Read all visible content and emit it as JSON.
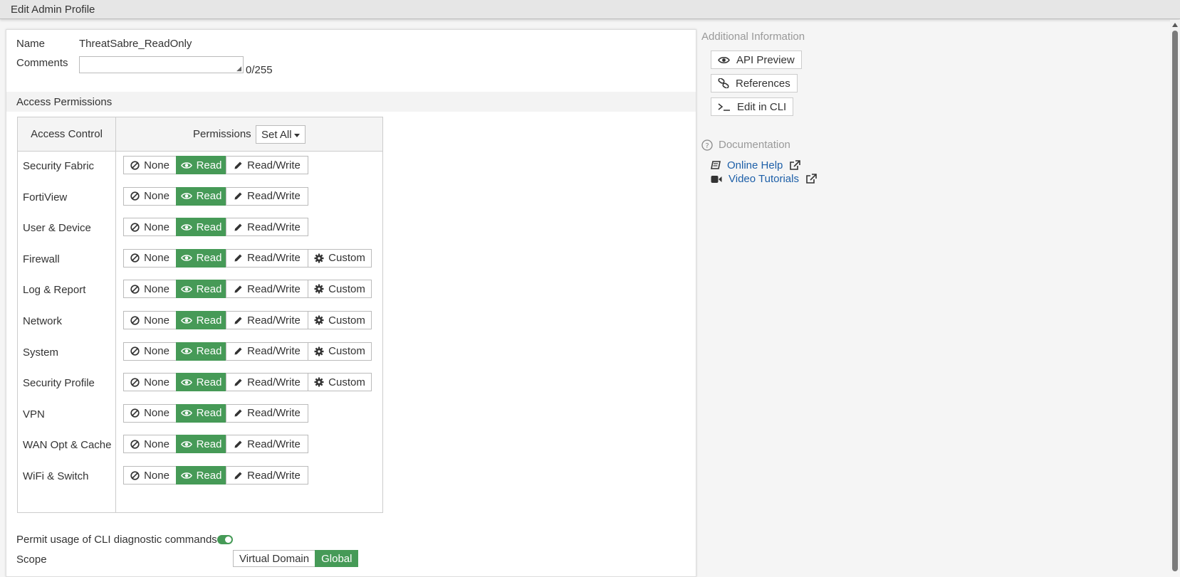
{
  "window": {
    "title": "Edit Admin Profile"
  },
  "form": {
    "name_label": "Name",
    "name_value": "ThreatSabre_ReadOnly",
    "comments_label": "Comments",
    "comments_value": "",
    "comments_count": "0/255"
  },
  "access": {
    "section_title": "Access Permissions",
    "col_access": "Access Control",
    "col_permissions": "Permissions",
    "set_all_label": "Set All",
    "option_labels": {
      "none": "None",
      "read": "Read",
      "readwrite": "Read/Write",
      "custom": "Custom"
    },
    "rows": [
      {
        "label": "Security Fabric",
        "selected": "read",
        "custom": false
      },
      {
        "label": "FortiView",
        "selected": "read",
        "custom": false
      },
      {
        "label": "User & Device",
        "selected": "read",
        "custom": false
      },
      {
        "label": "Firewall",
        "selected": "read",
        "custom": true
      },
      {
        "label": "Log & Report",
        "selected": "read",
        "custom": true
      },
      {
        "label": "Network",
        "selected": "read",
        "custom": true
      },
      {
        "label": "System",
        "selected": "read",
        "custom": true
      },
      {
        "label": "Security Profile",
        "selected": "read",
        "custom": true
      },
      {
        "label": "VPN",
        "selected": "read",
        "custom": false
      },
      {
        "label": "WAN Opt & Cache",
        "selected": "read",
        "custom": false
      },
      {
        "label": "WiFi & Switch",
        "selected": "read",
        "custom": false
      }
    ]
  },
  "cli": {
    "label": "Permit usage of CLI diagnostic commands",
    "enabled": true
  },
  "scope": {
    "label": "Scope",
    "options": [
      "Virtual Domain",
      "Global"
    ],
    "selected": "Global"
  },
  "side": {
    "title": "Additional Information",
    "api_preview": "API Preview",
    "references": "References",
    "edit_cli": "Edit in CLI",
    "doc_title": "Documentation",
    "online_help": "Online Help",
    "video_tutorials": "Video Tutorials"
  },
  "colors": {
    "accent": "#469a57",
    "link": "#1d5fa8"
  },
  "icons": [
    "ban-icon",
    "eye-icon",
    "pencil-icon",
    "gear-icon",
    "link-icon",
    "terminal-icon",
    "question-circle-icon",
    "book-icon",
    "video-camera-icon",
    "external-link-icon"
  ]
}
